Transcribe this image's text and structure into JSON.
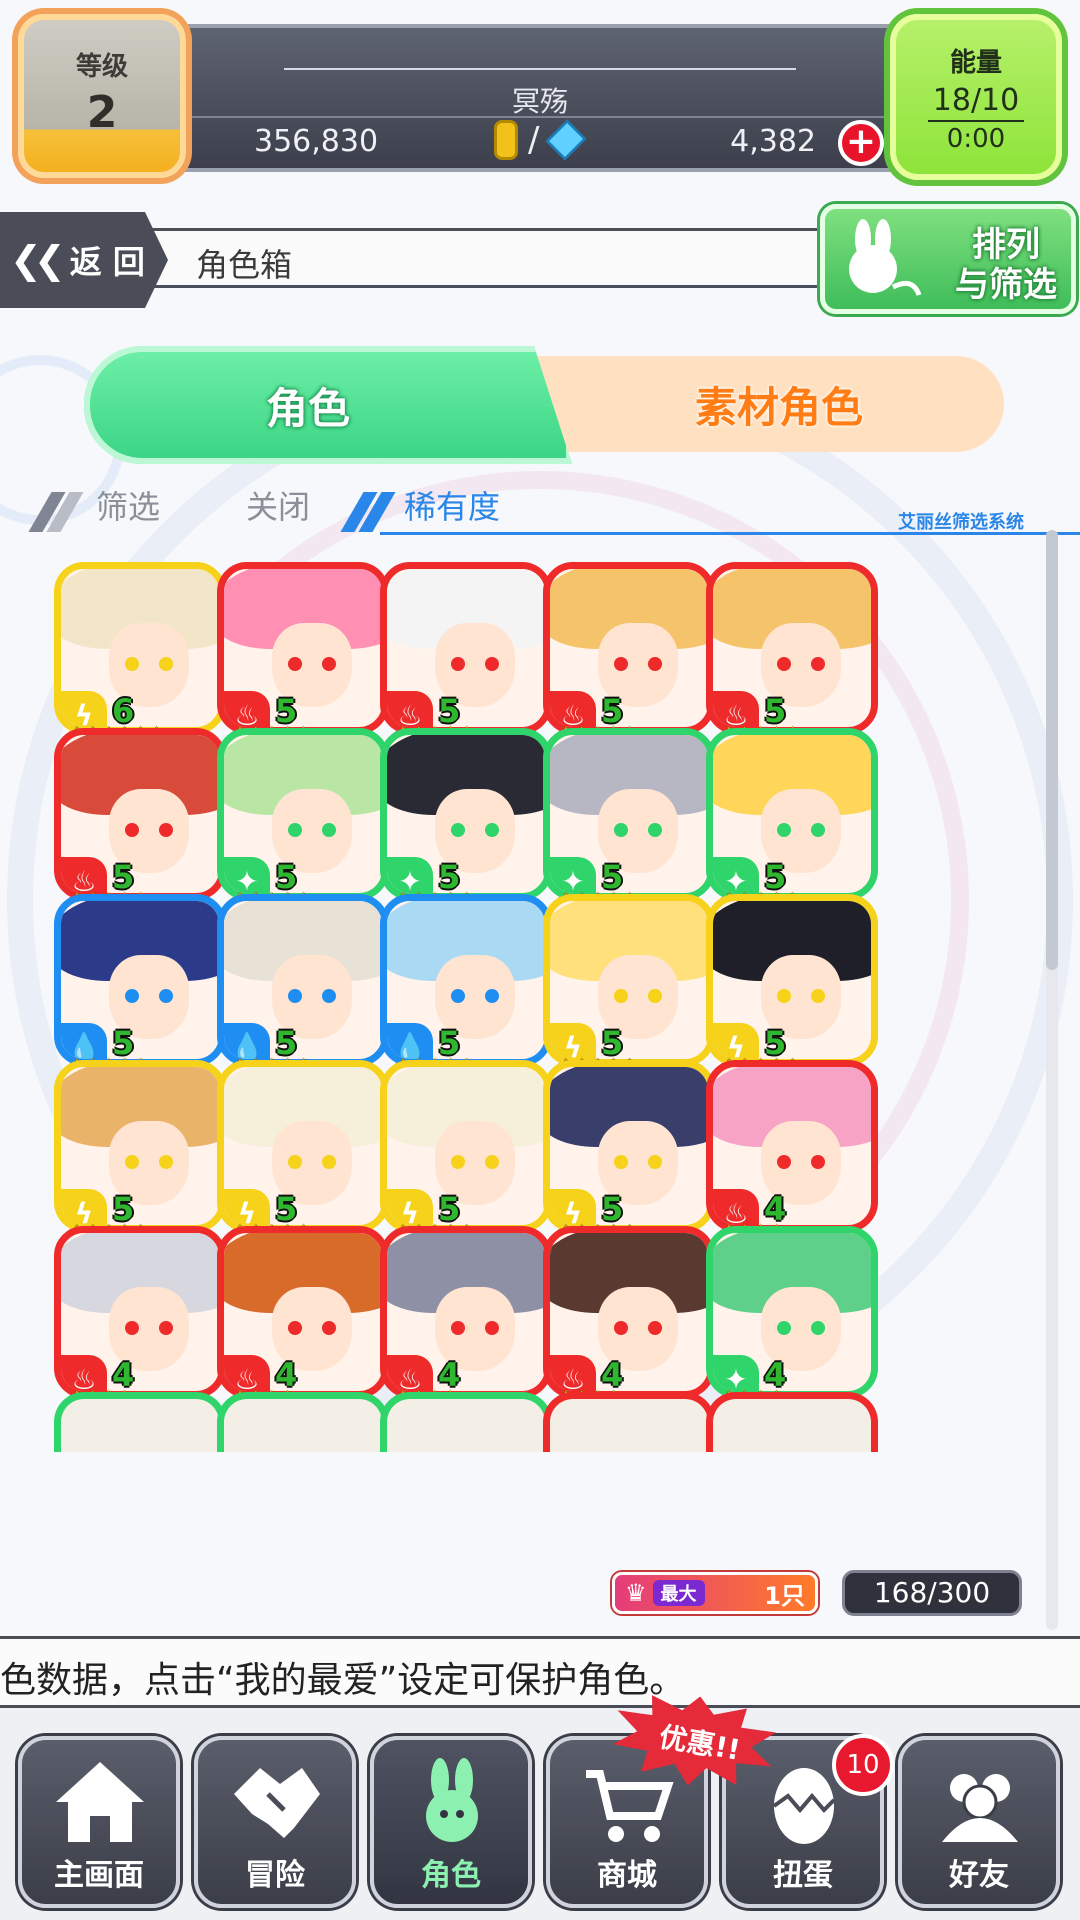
{
  "header": {
    "level_label": "等级",
    "level_value": "2",
    "player_name": "冥殇",
    "gold": "356,830",
    "gems": "4,382",
    "energy_label": "能量",
    "energy_value": "18/10",
    "energy_timer": "0:00"
  },
  "nav": {
    "back_label": "返 回",
    "title": "角色箱",
    "sort_line1": "排列",
    "sort_line2": "与筛选"
  },
  "tabs": {
    "characters": "角色",
    "materials": "素材角色"
  },
  "filter": {
    "filter_label": "筛选",
    "filter_state": "关闭",
    "sort_by": "稀有度",
    "system_label": "艾丽丝筛选系统"
  },
  "colors": {
    "red": "#ee2a2a",
    "yellow": "#f6d21a",
    "green": "#2fd46a",
    "blue": "#1f8ef2"
  },
  "characters": [
    {
      "element": "thunder",
      "color": "yellow",
      "rank": "6",
      "stars": 6
    },
    {
      "element": "fire",
      "color": "red",
      "rank": "5",
      "stars": 5
    },
    {
      "element": "fire",
      "color": "red",
      "rank": "5",
      "stars": 5
    },
    {
      "element": "fire",
      "color": "red",
      "rank": "5",
      "stars": 5
    },
    {
      "element": "fire",
      "color": "red",
      "rank": "5",
      "stars": 5
    },
    {
      "element": "fire",
      "color": "red",
      "rank": "5",
      "stars": 5
    },
    {
      "element": "wind",
      "color": "green",
      "rank": "5",
      "stars": 5
    },
    {
      "element": "wind",
      "color": "green",
      "rank": "5",
      "stars": 5
    },
    {
      "element": "wind",
      "color": "green",
      "rank": "5",
      "stars": 5
    },
    {
      "element": "wind",
      "color": "green",
      "rank": "5",
      "stars": 5
    },
    {
      "element": "water",
      "color": "blue",
      "rank": "5",
      "stars": 5
    },
    {
      "element": "water",
      "color": "blue",
      "rank": "5",
      "stars": 5
    },
    {
      "element": "water",
      "color": "blue",
      "rank": "5",
      "stars": 5
    },
    {
      "element": "thunder",
      "color": "yellow",
      "rank": "5",
      "stars": 5
    },
    {
      "element": "thunder",
      "color": "yellow",
      "rank": "5",
      "stars": 5
    },
    {
      "element": "thunder",
      "color": "yellow",
      "rank": "5",
      "stars": 5
    },
    {
      "element": "thunder",
      "color": "yellow",
      "rank": "5",
      "stars": 5
    },
    {
      "element": "thunder",
      "color": "yellow",
      "rank": "5",
      "stars": 5
    },
    {
      "element": "thunder",
      "color": "yellow",
      "rank": "5",
      "stars": 5
    },
    {
      "element": "fire",
      "color": "red",
      "rank": "4",
      "stars": 4
    },
    {
      "element": "fire",
      "color": "red",
      "rank": "4",
      "stars": 4
    },
    {
      "element": "fire",
      "color": "red",
      "rank": "4",
      "stars": 4
    },
    {
      "element": "fire",
      "color": "red",
      "rank": "4",
      "stars": 4
    },
    {
      "element": "fire",
      "color": "red",
      "rank": "4",
      "stars": 4
    },
    {
      "element": "wind",
      "color": "green",
      "rank": "4",
      "stars": 4
    }
  ],
  "partial_row_colors": [
    "green",
    "green",
    "green",
    "red",
    "red"
  ],
  "inventory": {
    "max_label": "最大",
    "max_count": "1只",
    "count": "168/300"
  },
  "ticker": "色数据，点击“我的最爱”设定可保护角色。",
  "bottom_nav": [
    {
      "label": "主画面",
      "icon": "home-icon"
    },
    {
      "label": "冒险",
      "icon": "handshake-icon"
    },
    {
      "label": "角色",
      "icon": "bunny-icon"
    },
    {
      "label": "商城",
      "icon": "cart-icon"
    },
    {
      "label": "扭蛋",
      "icon": "egg-icon"
    },
    {
      "label": "好友",
      "icon": "friends-icon"
    }
  ],
  "promo": "优惠!!",
  "gacha_badge": "10"
}
